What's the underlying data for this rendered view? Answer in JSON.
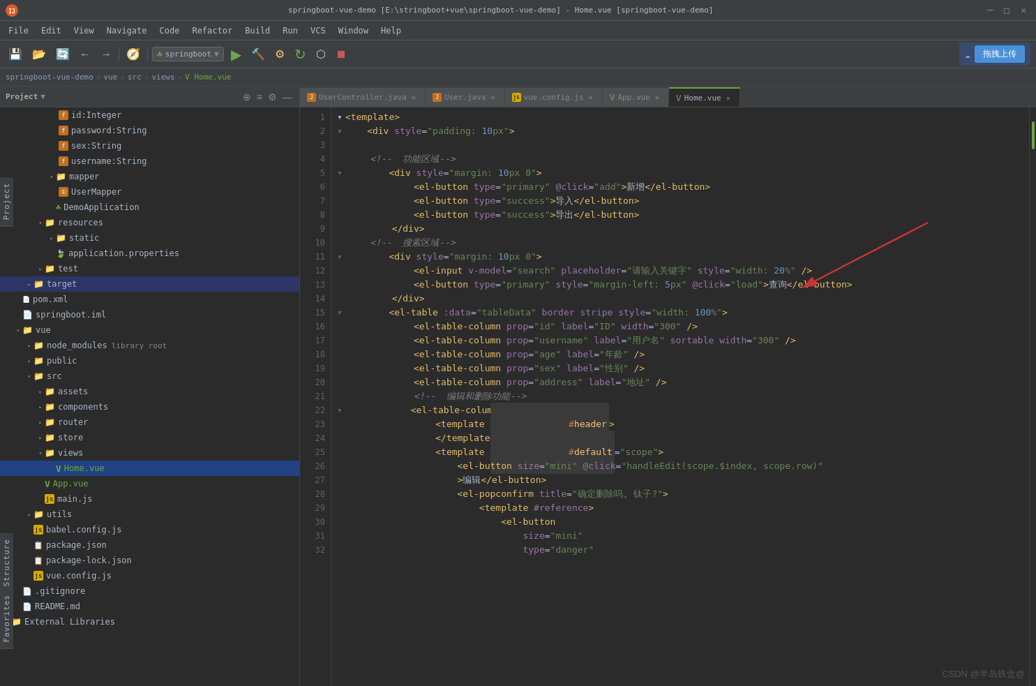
{
  "app": {
    "title": "springboot-vue-demo [E:\\stringboot+vue\\springboot-vue-demo] - Home.vue [springboot-vue-demo]",
    "icon_label": "IJ"
  },
  "menubar": {
    "items": [
      "File",
      "Edit",
      "View",
      "Navigate",
      "Code",
      "Refactor",
      "Build",
      "Run",
      "VCS",
      "Window",
      "Help"
    ]
  },
  "toolbar": {
    "springboot_label": "springboot",
    "upload_btn": "拖拽上传"
  },
  "breadcrumb": {
    "items": [
      "springboot-vue-demo",
      "vue",
      "src",
      "views",
      "Home.vue"
    ]
  },
  "tabs": [
    {
      "id": "usercontroller",
      "label": "UserController.java",
      "icon": "java",
      "active": false
    },
    {
      "id": "user",
      "label": "User.java",
      "icon": "java",
      "active": false
    },
    {
      "id": "vueconfig",
      "label": "vue.config.js",
      "icon": "json",
      "active": false
    },
    {
      "id": "appvue",
      "label": "App.vue",
      "icon": "vue",
      "active": false
    },
    {
      "id": "homevue",
      "label": "Home.vue",
      "icon": "vue",
      "active": true
    }
  ],
  "sidebar": {
    "title": "Project",
    "tree": [
      {
        "indent": 6,
        "type": "field",
        "icon": "f",
        "icon_color": "orange",
        "label": "id:Integer",
        "has_arrow": false
      },
      {
        "indent": 6,
        "type": "field",
        "icon": "f",
        "icon_color": "orange",
        "label": "password:String",
        "has_arrow": false
      },
      {
        "indent": 6,
        "type": "field",
        "icon": "f",
        "icon_color": "orange",
        "label": "sex:String",
        "has_arrow": false
      },
      {
        "indent": 6,
        "type": "field",
        "icon": "f",
        "icon_color": "orange",
        "label": "username:String",
        "has_arrow": false
      },
      {
        "indent": 4,
        "type": "folder",
        "icon": "📁",
        "label": "mapper",
        "has_arrow": true,
        "expanded": true
      },
      {
        "indent": 5,
        "type": "file",
        "icon": "①",
        "icon_color": "#c07020",
        "label": "UserMapper",
        "has_arrow": false
      },
      {
        "indent": 4,
        "type": "file",
        "icon": "☘",
        "icon_color": "#c8a015",
        "label": "DemoApplication",
        "has_arrow": false
      },
      {
        "indent": 3,
        "type": "folder",
        "icon": "📁",
        "label": "resources",
        "has_arrow": true,
        "expanded": true
      },
      {
        "indent": 4,
        "type": "folder",
        "icon": "📁",
        "label": "static",
        "has_arrow": false
      },
      {
        "indent": 4,
        "type": "file",
        "icon": "🍃",
        "icon_color": "#6da741",
        "label": "application.properties",
        "has_arrow": false
      },
      {
        "indent": 3,
        "type": "folder",
        "icon": "📁",
        "label": "test",
        "has_arrow": true
      },
      {
        "indent": 2,
        "type": "folder",
        "icon": "📁",
        "icon_color": "#c8a015",
        "label": "target",
        "has_arrow": true,
        "selected": true
      },
      {
        "indent": 1,
        "type": "file",
        "icon": "xml",
        "label": "pom.xml",
        "has_arrow": false
      },
      {
        "indent": 1,
        "type": "file",
        "icon": "iml",
        "label": "springboot.iml",
        "has_arrow": false
      },
      {
        "indent": 1,
        "type": "folder",
        "icon": "📁",
        "label": "vue",
        "has_arrow": true,
        "expanded": true
      },
      {
        "indent": 2,
        "type": "folder",
        "icon": "📁",
        "label": "node_modules",
        "has_arrow": true,
        "secondary": "library root"
      },
      {
        "indent": 2,
        "type": "folder",
        "icon": "📁",
        "label": "public",
        "has_arrow": true
      },
      {
        "indent": 2,
        "type": "folder",
        "icon": "📁",
        "label": "src",
        "has_arrow": true,
        "expanded": true
      },
      {
        "indent": 3,
        "type": "folder",
        "icon": "📁",
        "label": "assets",
        "has_arrow": true
      },
      {
        "indent": 3,
        "type": "folder",
        "icon": "📁",
        "label": "components",
        "has_arrow": true
      },
      {
        "indent": 3,
        "type": "folder",
        "icon": "📁",
        "label": "router",
        "has_arrow": true
      },
      {
        "indent": 3,
        "type": "folder",
        "icon": "📁",
        "label": "store",
        "has_arrow": true
      },
      {
        "indent": 3,
        "type": "folder",
        "icon": "📁",
        "label": "views",
        "has_arrow": true,
        "expanded": true
      },
      {
        "indent": 4,
        "type": "vue",
        "icon": "V",
        "label": "Home.vue",
        "has_arrow": false,
        "selected": true
      },
      {
        "indent": 3,
        "type": "vue",
        "icon": "V",
        "label": "App.vue",
        "has_arrow": false
      },
      {
        "indent": 3,
        "type": "js",
        "icon": "js",
        "label": "main.js",
        "has_arrow": false
      },
      {
        "indent": 2,
        "type": "folder",
        "icon": "📁",
        "label": "utils",
        "has_arrow": true
      },
      {
        "indent": 2,
        "type": "js",
        "icon": "js",
        "label": "babel.config.js",
        "has_arrow": false
      },
      {
        "indent": 2,
        "type": "json",
        "icon": "{}",
        "label": "package.json",
        "has_arrow": false
      },
      {
        "indent": 2,
        "type": "json",
        "icon": "{}",
        "label": "package-lock.json",
        "has_arrow": false
      },
      {
        "indent": 2,
        "type": "json",
        "icon": "js",
        "label": "vue.config.js",
        "has_arrow": false
      },
      {
        "indent": 1,
        "type": "git",
        "icon": ".git",
        "label": ".gitignore",
        "has_arrow": false
      },
      {
        "indent": 1,
        "type": "md",
        "icon": "md",
        "label": "README.md",
        "has_arrow": false
      },
      {
        "indent": 0,
        "type": "folder",
        "icon": "📁",
        "label": "External Libraries",
        "has_arrow": true
      }
    ]
  },
  "code": {
    "lines": [
      {
        "num": 1,
        "fold": false,
        "content": "<template>"
      },
      {
        "num": 2,
        "fold": true,
        "content": "    <div style=\"padding: 10px\">"
      },
      {
        "num": 3,
        "fold": false,
        "content": ""
      },
      {
        "num": 4,
        "fold": false,
        "content": "    <!--  功能区域-->",
        "type": "comment_mixed"
      },
      {
        "num": 5,
        "fold": true,
        "content": "        <div style=\"margin: 10px 0\">"
      },
      {
        "num": 6,
        "fold": false,
        "content": "            <el-button type=\"primary\" @click=\"add\">新增</el-button>"
      },
      {
        "num": 7,
        "fold": false,
        "content": "            <el-button type=\"success\">导入</el-button>"
      },
      {
        "num": 8,
        "fold": false,
        "content": "            <el-button type=\"success\">导出</el-button>"
      },
      {
        "num": 9,
        "fold": false,
        "content": "        </div>"
      },
      {
        "num": 10,
        "fold": false,
        "content": "    <!--  搜索区域-->",
        "type": "comment_mixed"
      },
      {
        "num": 11,
        "fold": true,
        "content": "        <div style=\"margin: 10px 0\">"
      },
      {
        "num": 12,
        "fold": false,
        "content": "            <el-input v-model=\"search\" placeholder=\"请输入关键字\" style=\"width: 20%\" />"
      },
      {
        "num": 13,
        "fold": false,
        "content": "            <el-button type=\"primary\" style=\"margin-left: 5px\" @click=\"load\">查询</el-button>"
      },
      {
        "num": 14,
        "fold": false,
        "content": "        </div>"
      },
      {
        "num": 15,
        "fold": true,
        "content": "        <el-table :data=\"tableData\" border stripe style=\"width: 100%\">"
      },
      {
        "num": 16,
        "fold": false,
        "content": "            <el-table-column prop=\"id\" label=\"ID\" width=\"300\" />"
      },
      {
        "num": 17,
        "fold": false,
        "content": "            <el-table-column prop=\"username\" label=\"用户名\" sortable width=\"300\" />"
      },
      {
        "num": 18,
        "fold": false,
        "content": "            <el-table-column prop=\"age\" label=\"年龄\" />"
      },
      {
        "num": 19,
        "fold": false,
        "content": "            <el-table-column prop=\"sex\" label=\"性别\" />"
      },
      {
        "num": 20,
        "fold": false,
        "content": "            <el-table-column prop=\"address\" label=\"地址\" />"
      },
      {
        "num": 21,
        "fold": false,
        "content": "            <!--  编辑和删除功能-->",
        "type": "comment"
      },
      {
        "num": 22,
        "fold": true,
        "content": "            <el-table-column align=\"right\">"
      },
      {
        "num": 23,
        "fold": false,
        "content": "                <template #header>"
      },
      {
        "num": 24,
        "fold": false,
        "content": "                </template>"
      },
      {
        "num": 25,
        "fold": false,
        "content": "                <template #default=\"scope\">"
      },
      {
        "num": 26,
        "fold": false,
        "content": "                    <el-button size=\"mini\" @click=\"handleEdit(scope.$index, scope.row)\""
      },
      {
        "num": 27,
        "fold": false,
        "content": "                    >编辑</el-button>"
      },
      {
        "num": 28,
        "fold": false,
        "content": "                    <el-popconfirm title=\"确定删除吗, 钛子?\">"
      },
      {
        "num": 29,
        "fold": false,
        "content": "                        <template #reference>"
      },
      {
        "num": 30,
        "fold": false,
        "content": "                            <el-button"
      },
      {
        "num": 31,
        "fold": false,
        "content": "                                size=\"mini\""
      },
      {
        "num": 32,
        "fold": false,
        "content": "                                type=\"danger\""
      }
    ]
  },
  "watermark": "CSDN @半岛铁盒@"
}
